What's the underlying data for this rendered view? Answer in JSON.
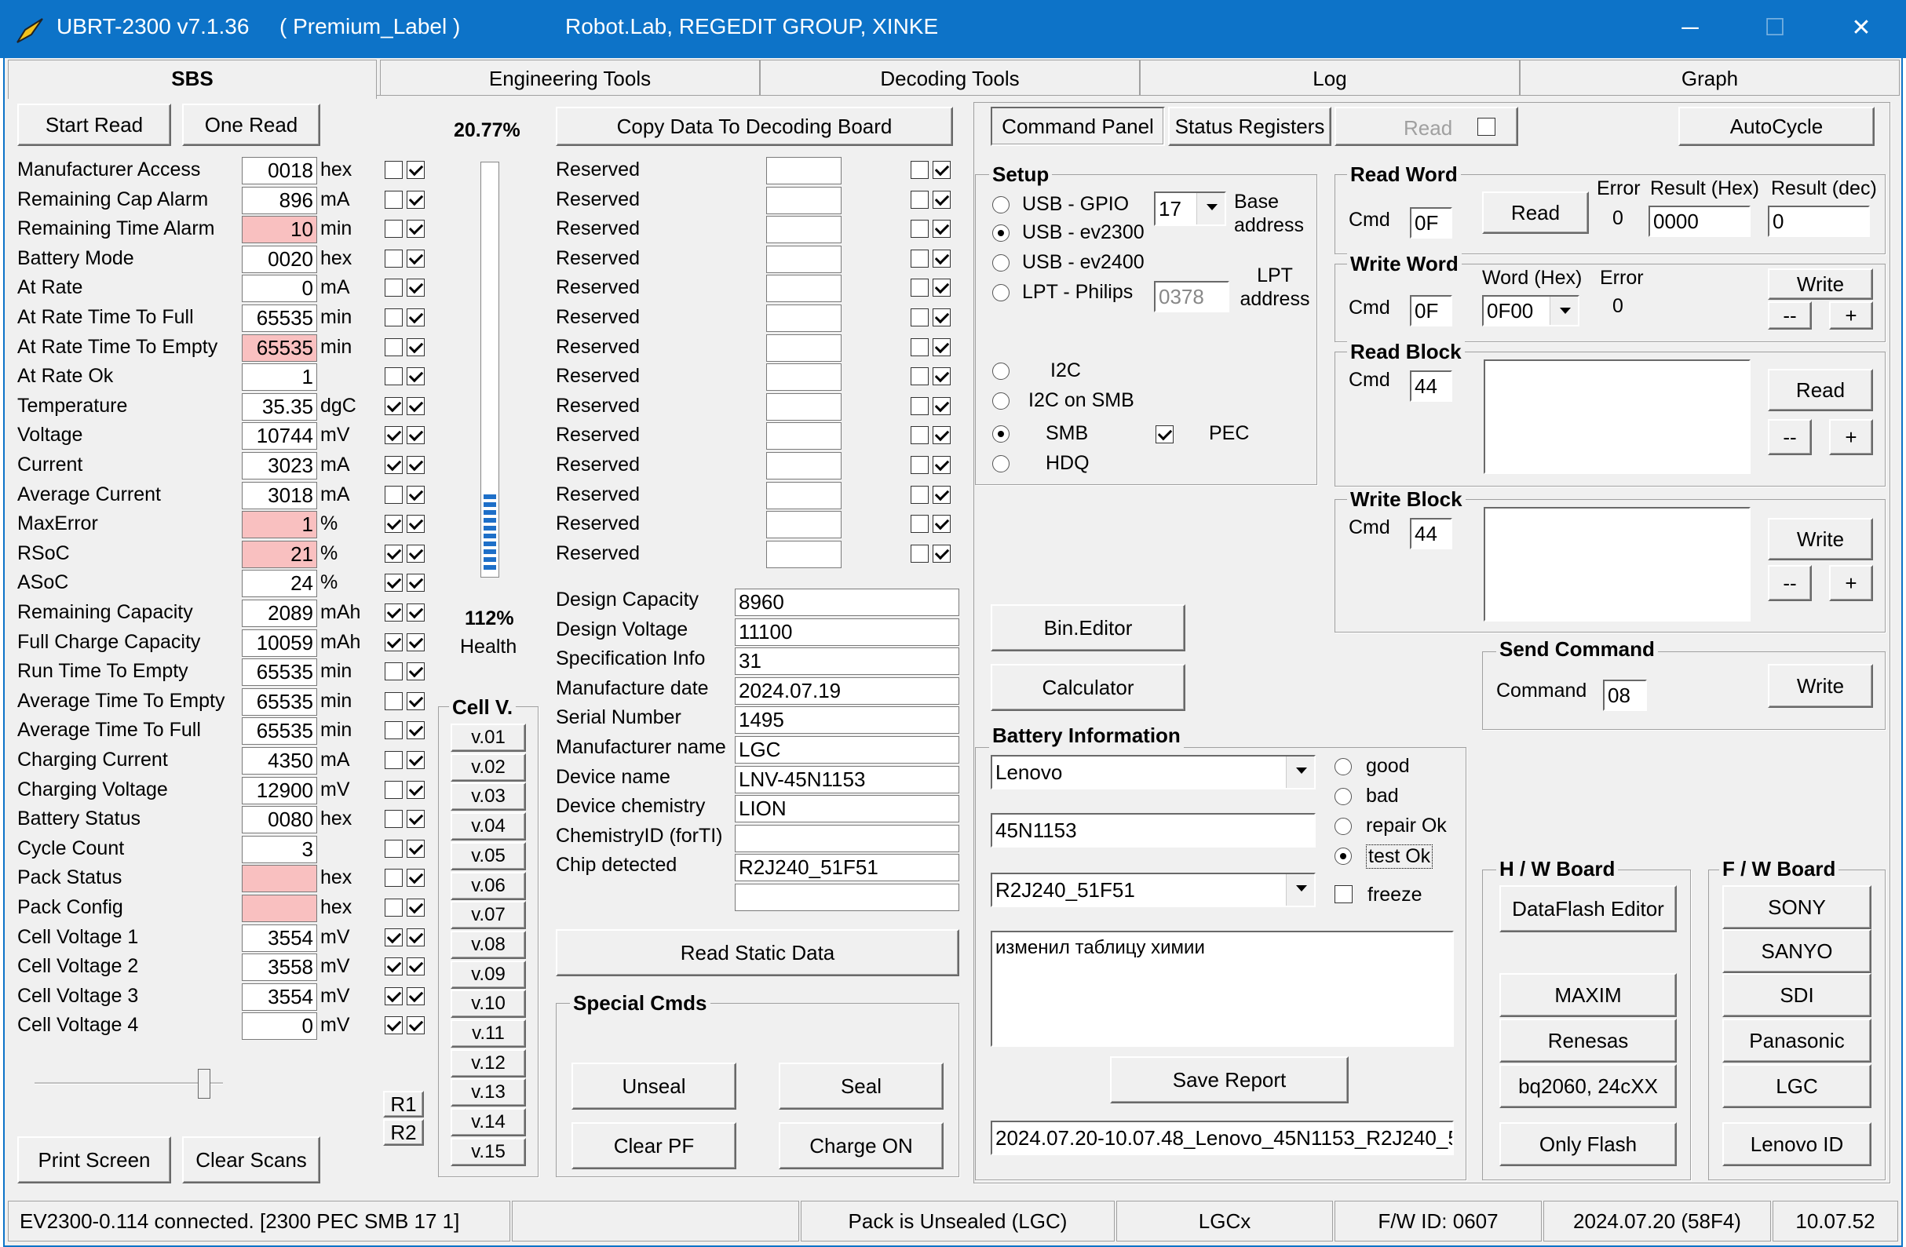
{
  "app": {
    "title": "UBRT-2300 v7.1.36",
    "label": "( Premium_Label )",
    "company": "Robot.Lab,  REGEDIT GROUP,  XINKE",
    "min": "─",
    "max": "☐",
    "close": "✕"
  },
  "tabs": [
    "SBS",
    "Engineering Tools",
    "Decoding Tools",
    "Log",
    "Graph"
  ],
  "sbs": {
    "start_read": "Start Read",
    "one_read": "One Read",
    "print_screen": "Print Screen",
    "clear_scans": "Clear Scans",
    "r1": "R1",
    "r2": "R2",
    "rows": [
      {
        "label": "Manufacturer Access",
        "value": "0018",
        "unit": "hex",
        "red": false,
        "c1": false,
        "c2": true
      },
      {
        "label": "Remaining Cap Alarm",
        "value": "896",
        "unit": "mA",
        "red": false,
        "c1": false,
        "c2": true
      },
      {
        "label": "Remaining Time Alarm",
        "value": "10",
        "unit": "min",
        "red": true,
        "c1": false,
        "c2": true
      },
      {
        "label": "Battery Mode",
        "value": "0020",
        "unit": "hex",
        "red": false,
        "c1": false,
        "c2": true
      },
      {
        "label": "At Rate",
        "value": "0",
        "unit": "mA",
        "red": false,
        "c1": false,
        "c2": true
      },
      {
        "label": "At Rate Time To Full",
        "value": "65535",
        "unit": "min",
        "red": false,
        "c1": false,
        "c2": true
      },
      {
        "label": "At Rate Time To Empty",
        "value": "65535",
        "unit": "min",
        "red": true,
        "c1": false,
        "c2": true
      },
      {
        "label": "At Rate Ok",
        "value": "1",
        "unit": "",
        "red": false,
        "c1": false,
        "c2": true
      },
      {
        "label": "Temperature",
        "value": "35.35",
        "unit": "dgC",
        "red": false,
        "c1": true,
        "c2": true
      },
      {
        "label": "Voltage",
        "value": "10744",
        "unit": "mV",
        "red": false,
        "c1": true,
        "c2": true
      },
      {
        "label": "Current",
        "value": "3023",
        "unit": "mA",
        "red": false,
        "c1": true,
        "c2": true
      },
      {
        "label": "Average Current",
        "value": "3018",
        "unit": "mA",
        "red": false,
        "c1": false,
        "c2": true
      },
      {
        "label": "MaxError",
        "value": "1",
        "unit": "%",
        "red": true,
        "c1": true,
        "c2": true
      },
      {
        "label": "RSoC",
        "value": "21",
        "unit": "%",
        "red": true,
        "c1": true,
        "c2": true
      },
      {
        "label": "ASoC",
        "value": "24",
        "unit": "%",
        "red": false,
        "c1": true,
        "c2": true
      },
      {
        "label": "Remaining Capacity",
        "value": "2089",
        "unit": "mAh",
        "red": false,
        "c1": true,
        "c2": true
      },
      {
        "label": "Full Charge Capacity",
        "value": "10059",
        "unit": "mAh",
        "red": false,
        "c1": true,
        "c2": true
      },
      {
        "label": "Run Time To Empty",
        "value": "65535",
        "unit": "min",
        "red": false,
        "c1": false,
        "c2": true
      },
      {
        "label": "Average Time To Empty",
        "value": "65535",
        "unit": "min",
        "red": false,
        "c1": false,
        "c2": true
      },
      {
        "label": "Average Time To Full",
        "value": "65535",
        "unit": "min",
        "red": false,
        "c1": false,
        "c2": true
      },
      {
        "label": "Charging Current",
        "value": "4350",
        "unit": "mA",
        "red": false,
        "c1": false,
        "c2": true
      },
      {
        "label": "Charging Voltage",
        "value": "12900",
        "unit": "mV",
        "red": false,
        "c1": false,
        "c2": true
      },
      {
        "label": "Battery Status",
        "value": "0080",
        "unit": "hex",
        "red": false,
        "c1": false,
        "c2": true
      },
      {
        "label": "Cycle Count",
        "value": "3",
        "unit": "",
        "red": false,
        "c1": false,
        "c2": true
      },
      {
        "label": "Pack Status",
        "value": "",
        "unit": "hex",
        "red": true,
        "c1": false,
        "c2": true
      },
      {
        "label": "Pack Config",
        "value": "",
        "unit": "hex",
        "red": true,
        "c1": false,
        "c2": true
      },
      {
        "label": "Cell Voltage 1",
        "value": "3554",
        "unit": "mV",
        "red": false,
        "c1": true,
        "c2": true
      },
      {
        "label": "Cell Voltage 2",
        "value": "3558",
        "unit": "mV",
        "red": false,
        "c1": true,
        "c2": true
      },
      {
        "label": "Cell Voltage 3",
        "value": "3554",
        "unit": "mV",
        "red": false,
        "c1": true,
        "c2": true
      },
      {
        "label": "Cell Voltage 4",
        "value": "0",
        "unit": "mV",
        "red": false,
        "c1": true,
        "c2": true
      }
    ]
  },
  "gauge": {
    "percent": "20.77%",
    "fill": 0.2077,
    "health": "112%",
    "health_label": "Health"
  },
  "cellv": {
    "title": "Cell V.",
    "buttons": [
      "v.01",
      "v.02",
      "v.03",
      "v.04",
      "v.05",
      "v.06",
      "v.07",
      "v.08",
      "v.09",
      "v.10",
      "v.11",
      "v.12",
      "v.13",
      "v.14",
      "v.15"
    ]
  },
  "copy_button": "Copy Data To Decoding Board",
  "reserved": {
    "label": "Reserved",
    "count": 14
  },
  "static": {
    "read_button": "Read Static Data",
    "rows": [
      {
        "label": "Design Capacity",
        "value": "8960"
      },
      {
        "label": "Design Voltage",
        "value": "11100"
      },
      {
        "label": "Specification Info",
        "value": "31"
      },
      {
        "label": "Manufacture date",
        "value": "2024.07.19"
      },
      {
        "label": "Serial Number",
        "value": "1495"
      },
      {
        "label": "Manufacturer name",
        "value": "LGC"
      },
      {
        "label": "Device name",
        "value": "LNV-45N1153"
      },
      {
        "label": "Device chemistry",
        "value": "LION"
      },
      {
        "label": "ChemistryID (forTI)",
        "value": ""
      },
      {
        "label": "Chip detected",
        "value": "R2J240_51F51"
      },
      {
        "label": "",
        "value": ""
      }
    ]
  },
  "special": {
    "title": "Special Cmds",
    "unseal": "Unseal",
    "seal": "Seal",
    "clear_pf": "Clear PF",
    "charge_on": "Charge ON"
  },
  "cmdpanel": {
    "tab1": "Command Panel",
    "tab2": "Status Registers",
    "read": "Read",
    "autocycle": "AutoCycle"
  },
  "setup": {
    "title": "Setup",
    "usb_gpio": "USB - GPIO",
    "usb_ev2300": "USB - ev2300",
    "usb_ev2400": "USB - ev2400",
    "lpt": "LPT  - Philips",
    "base": "17",
    "base_label": "Base address",
    "lpt_addr": "0378",
    "lpt_label": "LPT address",
    "i2c": "I2C",
    "i2c_smb": "I2C on SMB",
    "smb": "SMB",
    "hdq": "HDQ",
    "pec": "PEC"
  },
  "readword": {
    "title": "Read Word",
    "cmd_label": "Cmd",
    "cmd": "0F",
    "read": "Read",
    "error_label": "Error",
    "error": "0",
    "hex_label": "Result (Hex)",
    "hex": "0000",
    "dec_label": "Result (dec)",
    "dec": "0"
  },
  "writeword": {
    "title": "Write Word",
    "cmd_label": "Cmd",
    "cmd": "0F",
    "word_label": "Word (Hex)",
    "word": "0F00",
    "error_label": "Error",
    "error": "0",
    "write": "Write",
    "minus": "--",
    "plus": "+"
  },
  "readblock": {
    "title": "Read Block",
    "cmd_label": "Cmd",
    "cmd": "44",
    "read": "Read",
    "minus": "--",
    "plus": "+"
  },
  "writeblock": {
    "title": "Write Block",
    "cmd_label": "Cmd",
    "cmd": "44",
    "write": "Write",
    "minus": "--",
    "plus": "+"
  },
  "sendcmd": {
    "title": "Send Command",
    "label": "Command",
    "value": "08",
    "write": "Write"
  },
  "tools": {
    "bin_editor": "Bin.Editor",
    "calculator": "Calculator"
  },
  "batinfo": {
    "title": "Battery Information",
    "brand": "Lenovo",
    "part": "45N1153",
    "chip": "R2J240_51F51",
    "good": "good",
    "bad": "bad",
    "repair": "repair Ok",
    "test": "test   Ok",
    "freeze": "freeze",
    "note": "изменил таблицу химии",
    "save": "Save Report",
    "filename": "2024.07.20-10.07.48_Lenovo_45N1153_R2J240_5"
  },
  "hw": {
    "title": "H / W   Board",
    "dataflash": "DataFlash Editor",
    "maxim": "MAXIM",
    "renesas": "Renesas",
    "bq": "bq2060, 24cXX",
    "only_flash": "Only Flash"
  },
  "fw": {
    "title": "F / W   Board",
    "sony": "SONY",
    "sanyo": "SANYO",
    "sdi": "SDI",
    "panasonic": "Panasonic",
    "lgc": "LGC",
    "lenovo": "Lenovo ID"
  },
  "status": {
    "conn": "EV2300-0.114 connected. [2300  PEC  SMB  17 1]",
    "blank": "",
    "seal": "Pack is Unsealed  (LGC)",
    "lgcx": "LGCx",
    "fw": "F/W ID: 0607",
    "date": "2024.07.20  (58F4)",
    "time": "10.07.52"
  }
}
